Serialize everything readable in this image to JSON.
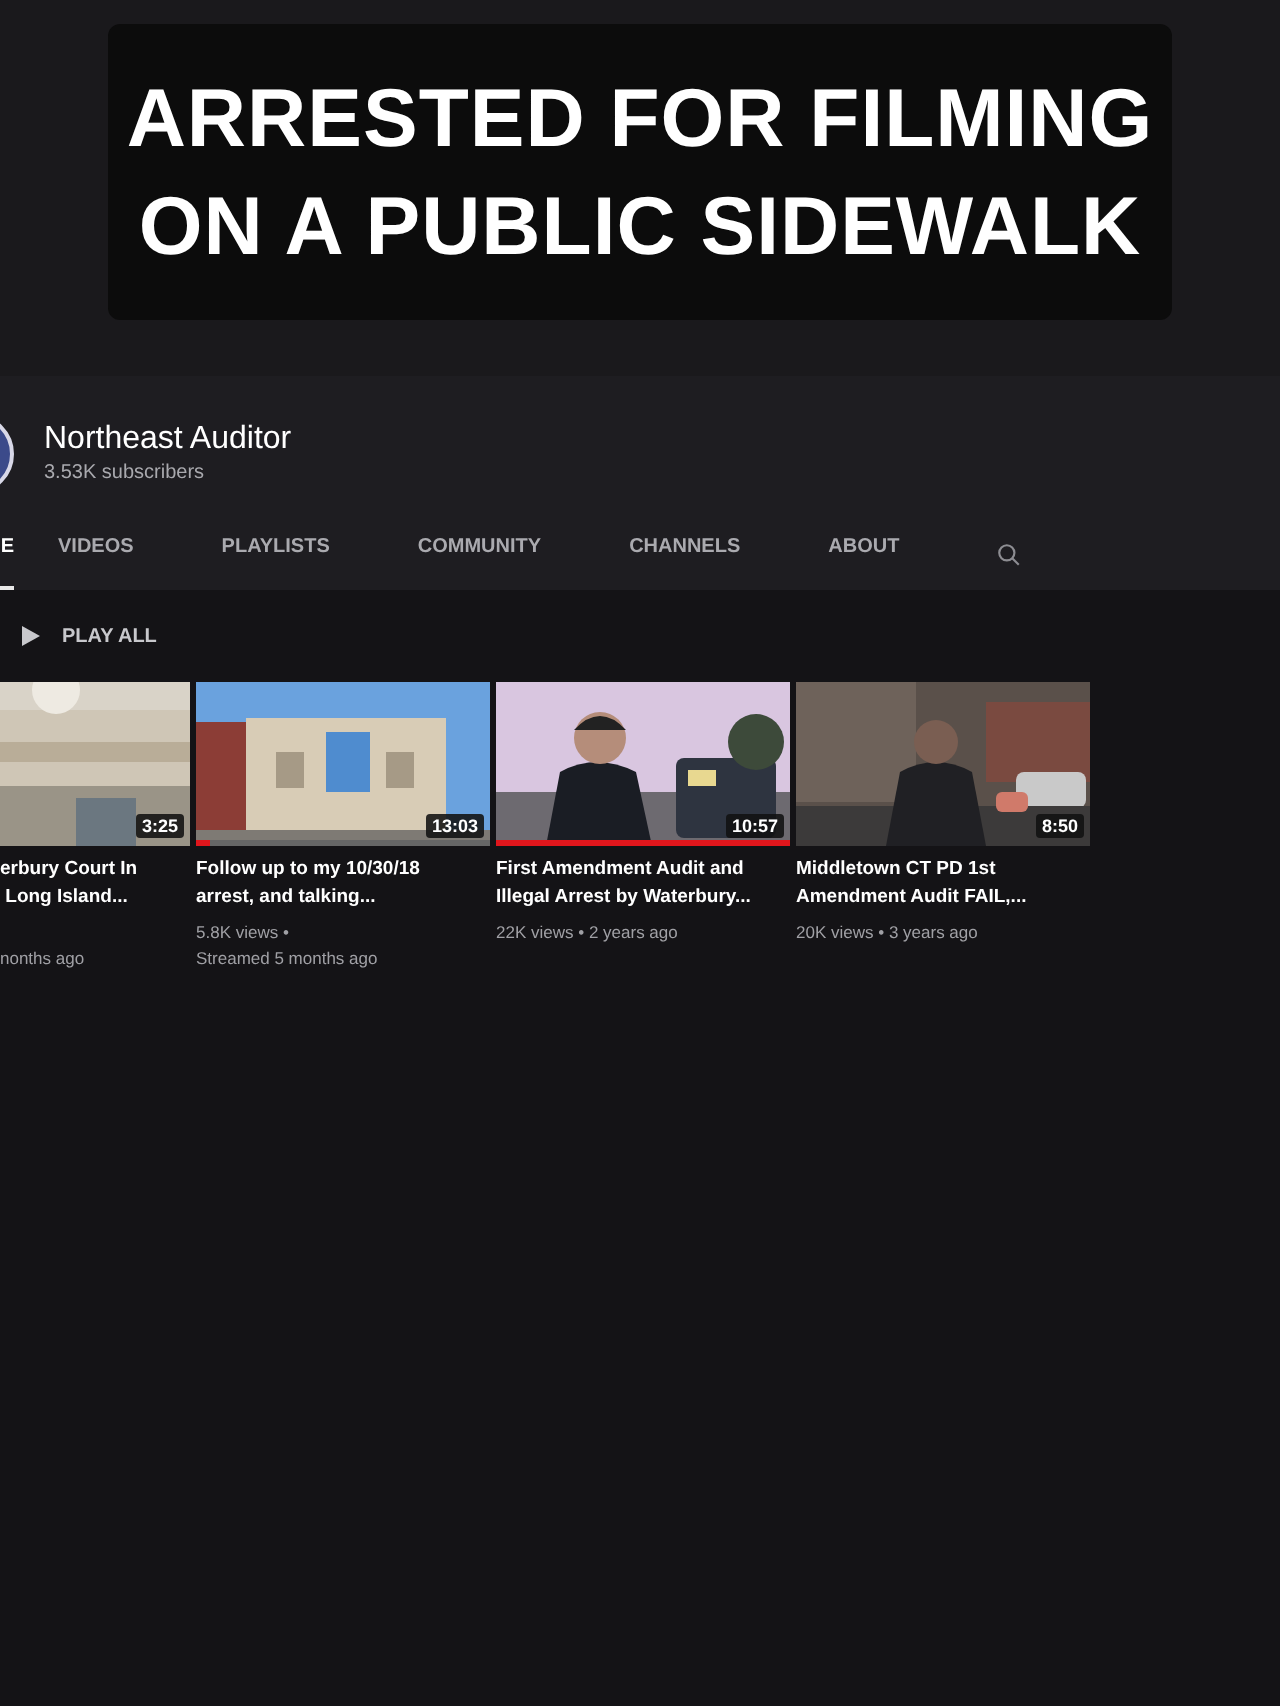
{
  "caption": {
    "lines": [
      "ARRESTED FOR FILMING",
      "ON A PUBLIC SIDEWALK"
    ]
  },
  "channel": {
    "name": "Northeast Auditor",
    "subscribers": "3.53K subscribers"
  },
  "tabs": [
    {
      "label": "E",
      "selected": true
    },
    {
      "label": "VIDEOS",
      "selected": false
    },
    {
      "label": "PLAYLISTS",
      "selected": false
    },
    {
      "label": "COMMUNITY",
      "selected": false
    },
    {
      "label": "CHANNELS",
      "selected": false
    },
    {
      "label": "ABOUT",
      "selected": false
    }
  ],
  "play_all": "PLAY ALL",
  "videos": [
    {
      "duration": "3:25",
      "title_lines": [
        "erbury Court In",
        " Long Island..."
      ],
      "meta_lines": [
        "nonths ago"
      ]
    },
    {
      "duration": "13:03",
      "level": 0.05,
      "title_lines": [
        "Follow up to my 10/30/18",
        "arrest, and talking..."
      ],
      "meta_lines": [
        "5.8K views •",
        "Streamed 5 months ago"
      ]
    },
    {
      "duration": "10:57",
      "level": 1,
      "title_lines": [
        "First Amendment Audit and",
        "Illegal Arrest by Waterbury..."
      ],
      "meta_lines": [
        "22K views • 2 years ago"
      ]
    },
    {
      "duration": "8:50",
      "title_lines": [
        "Middletown CT PD 1st",
        "Amendment Audit FAIL,..."
      ],
      "meta_lines": [
        "20K views • 3 years ago"
      ]
    }
  ]
}
